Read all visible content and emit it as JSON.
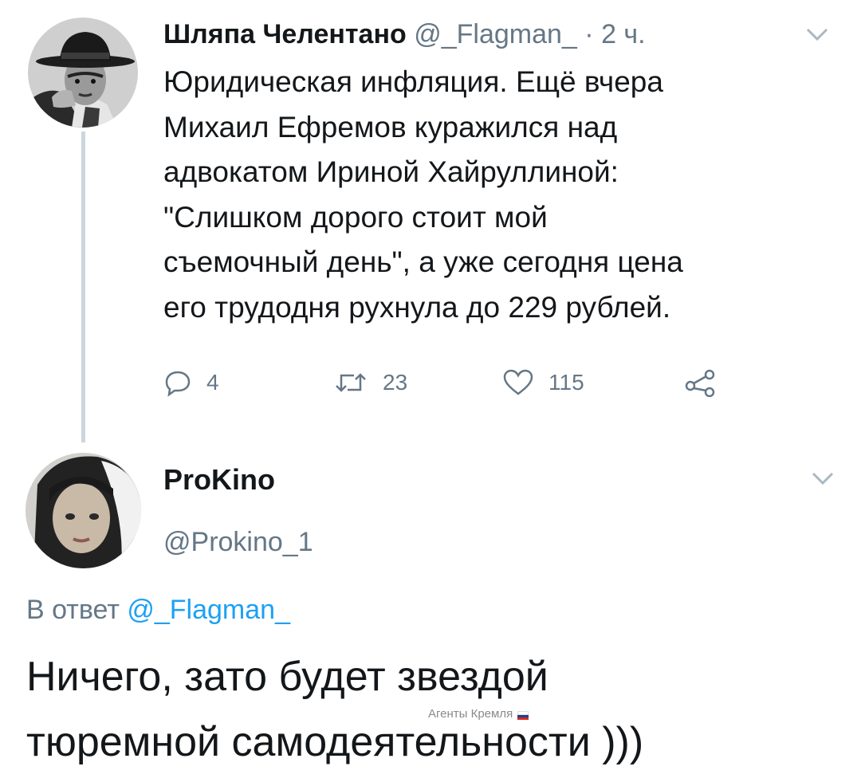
{
  "tweet1": {
    "author_name": "Шляпа Челентано",
    "handle": "@_Flagman_",
    "separator": "·",
    "time": "2 ч.",
    "text_lines": [
      "Юридическая инфляция. Ещё вчера",
      "Михаил Ефремов куражился над",
      "адвокатом Ириной Хайруллиной:",
      "\"Слишком дорого стоит мой",
      "съемочный день\", а уже сегодня цена",
      "его трудодня рухнула до 229 рублей."
    ],
    "replies": "4",
    "retweets": "23",
    "likes": "115",
    "icons": [
      "reply-icon",
      "retweet-icon",
      "like-icon",
      "share-icon",
      "chevron-down-icon"
    ]
  },
  "tweet2": {
    "author_name": "ProKino",
    "handle": "@Prokino_1",
    "reply_prefix": "В ответ",
    "reply_to": "@_Flagman_",
    "text_lines": [
      "Ничего, зато будет звездой",
      "тюремной самодеятельности )))"
    ]
  },
  "watermark": {
    "text": "Агенты Кремля",
    "flag_colors": [
      "#ffffff",
      "#1c3f94",
      "#d52b1e"
    ]
  },
  "colors": {
    "text": "#14171a",
    "secondary": "#657786",
    "link": "#1da1f2",
    "thread_line": "#ccd6dd"
  }
}
